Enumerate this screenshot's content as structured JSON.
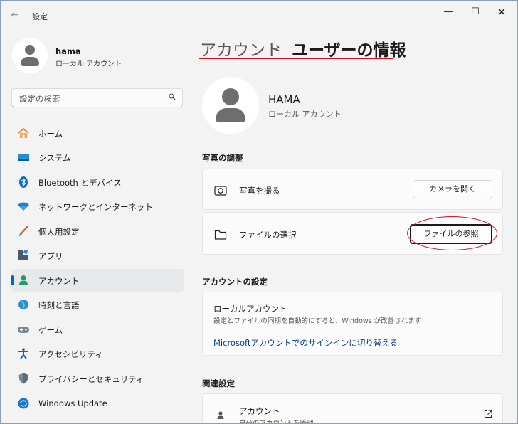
{
  "window": {
    "title": "設定",
    "back_glyph": "←",
    "minimize_glyph": "—",
    "maximize_glyph": "☐",
    "close_glyph": "✕"
  },
  "profile": {
    "name": "hama",
    "type": "ローカル アカウント"
  },
  "search": {
    "placeholder": "設定の検索"
  },
  "nav": {
    "items": [
      {
        "label": "ホーム",
        "icon": "home-icon",
        "active": false
      },
      {
        "label": "システム",
        "icon": "system-icon",
        "active": false
      },
      {
        "label": "Bluetooth とデバイス",
        "icon": "bluetooth-icon",
        "active": false
      },
      {
        "label": "ネットワークとインターネット",
        "icon": "network-icon",
        "active": false
      },
      {
        "label": "個人用設定",
        "icon": "personalization-icon",
        "active": false
      },
      {
        "label": "アプリ",
        "icon": "apps-icon",
        "active": false
      },
      {
        "label": "アカウント",
        "icon": "account-icon",
        "active": true
      },
      {
        "label": "時刻と言語",
        "icon": "time-language-icon",
        "active": false
      },
      {
        "label": "ゲーム",
        "icon": "gaming-icon",
        "active": false
      },
      {
        "label": "アクセシビリティ",
        "icon": "accessibility-icon",
        "active": false
      },
      {
        "label": "プライバシーとセキュリティ",
        "icon": "privacy-shield-icon",
        "active": false
      },
      {
        "label": "Windows Update",
        "icon": "windows-update-icon",
        "active": false
      }
    ]
  },
  "breadcrumb": {
    "parent": "アカウント",
    "separator": "›",
    "current": "ユーザーの情報"
  },
  "user": {
    "name": "HAMA",
    "type": "ローカル アカウント"
  },
  "photo_section": {
    "title": "写真の調整",
    "take_photo_label": "写真を撮る",
    "open_camera_button": "カメラを開く",
    "choose_file_label": "ファイルの選択",
    "browse_files_button": "ファイルの参照"
  },
  "account_section": {
    "title": "アカウントの設定",
    "local_title": "ローカルアカウント",
    "local_desc": "設定とファイルの同期を自動的にすると、Windows が改善されます",
    "switch_link": "Microsoftアカウントでのサインインに切り替える"
  },
  "related_section": {
    "title": "関連設定",
    "item_title": "アカウント",
    "item_sub": "自分のアカウントを管理"
  },
  "colors": {
    "accent": "#0067c0",
    "annotation_red": "#d0121b",
    "link": "#003e92"
  }
}
